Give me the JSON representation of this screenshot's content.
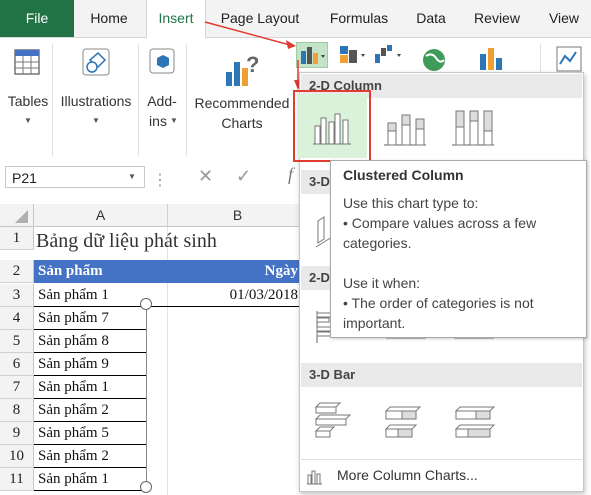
{
  "tabs": [
    {
      "label": "File"
    },
    {
      "label": "Home"
    },
    {
      "label": "Insert"
    },
    {
      "label": "Page Layout"
    },
    {
      "label": "Formulas"
    },
    {
      "label": "Data"
    },
    {
      "label": "Review"
    },
    {
      "label": "View"
    }
  ],
  "ribbon": {
    "tables": "Tables",
    "illustrations": "Illustrations",
    "addins_line1": "Add-",
    "addins_line2": "ins",
    "recommended_line1": "Recommended",
    "recommended_line2": "Charts"
  },
  "namebox": "P21",
  "formula_icons": {
    "cancel": "✕",
    "enter": "✓",
    "fx": "f"
  },
  "columns": [
    "A",
    "B"
  ],
  "rows": [
    {
      "num": "1",
      "a": "Bảng dữ liệu phát sinh",
      "b": ""
    },
    {
      "num": "2",
      "a": "Sản phẩm",
      "b": "Ngày"
    },
    {
      "num": "3",
      "a": "Sản phẩm 1",
      "b": "01/03/2018"
    },
    {
      "num": "4",
      "a": "Sản phẩm 7",
      "b": ""
    },
    {
      "num": "5",
      "a": "Sản phẩm 8",
      "b": ""
    },
    {
      "num": "6",
      "a": "Sản phẩm 9",
      "b": ""
    },
    {
      "num": "7",
      "a": "Sản phẩm 1",
      "b": ""
    },
    {
      "num": "8",
      "a": "Sản phẩm 2",
      "b": ""
    },
    {
      "num": "9",
      "a": "Sản phẩm 5",
      "b": ""
    },
    {
      "num": "10",
      "a": "Sản phẩm 2",
      "b": ""
    },
    {
      "num": "11",
      "a": "Sản phẩm 1",
      "b": ""
    }
  ],
  "dropdown": {
    "sec_2d_column": "2-D Column",
    "sec_3d_column_partial": "3-D",
    "sec_2d_bar_partial": "2-D",
    "sec_3d_bar": "3-D Bar",
    "more": "More Column Charts..."
  },
  "tooltip": {
    "title": "Clustered Column",
    "line1": "Use this chart type to:",
    "line2": "• Compare values across a few",
    "line3": "categories.",
    "line4": "Use it when:",
    "line5": "• The order of categories is not",
    "line6": "important."
  },
  "colors": {
    "excel_green": "#217346",
    "header_blue": "#4472c4",
    "highlight_red": "#e03c31",
    "selection_green": "#d9f2d9"
  }
}
